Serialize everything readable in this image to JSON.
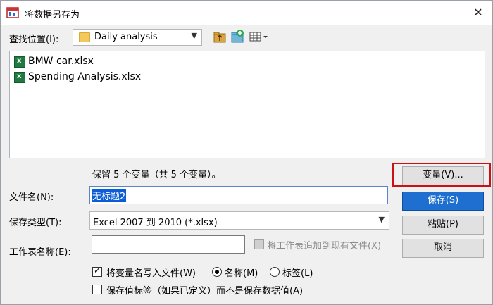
{
  "window": {
    "title": "将数据另存为"
  },
  "lookin": {
    "label": "查找位置(I):",
    "value": "Daily analysis"
  },
  "files": [
    {
      "name": "BMW car.xlsx"
    },
    {
      "name": "Spending  Analysis.xlsx"
    }
  ],
  "info": {
    "keep_text": "保留 5 个变量（共 5 个变量）。"
  },
  "fields": {
    "filename_label": "文件名(N):",
    "filename_value": "无标题2",
    "type_label": "保存类型(T):",
    "type_value": "Excel 2007 到 2010 (*.xlsx)",
    "sheet_label": "工作表名称(E):",
    "sheet_value": ""
  },
  "options": {
    "append_label": "将工作表追加到现有文件(X)",
    "write_varnames_label": "将变量名写入文件(W)",
    "write_varnames_checked": true,
    "radio_name_label": "名称(M)",
    "radio_label_label": "标签(L)",
    "radio_selected": "name",
    "save_value_labels_label": "保存值标签（如果已定义）而不是保存数据值(A)",
    "save_value_labels_checked": false
  },
  "buttons": {
    "variables": "变量(V)...",
    "save": "保存(S)",
    "paste": "粘贴(P)",
    "cancel": "取消"
  },
  "icons": {
    "close": "close-icon",
    "folder": "folder-icon",
    "excel": "excel-file-icon"
  },
  "colors": {
    "primary_button": "#1f6fd0",
    "selection": "#0b5cd7",
    "highlight_box": "#d01010"
  }
}
